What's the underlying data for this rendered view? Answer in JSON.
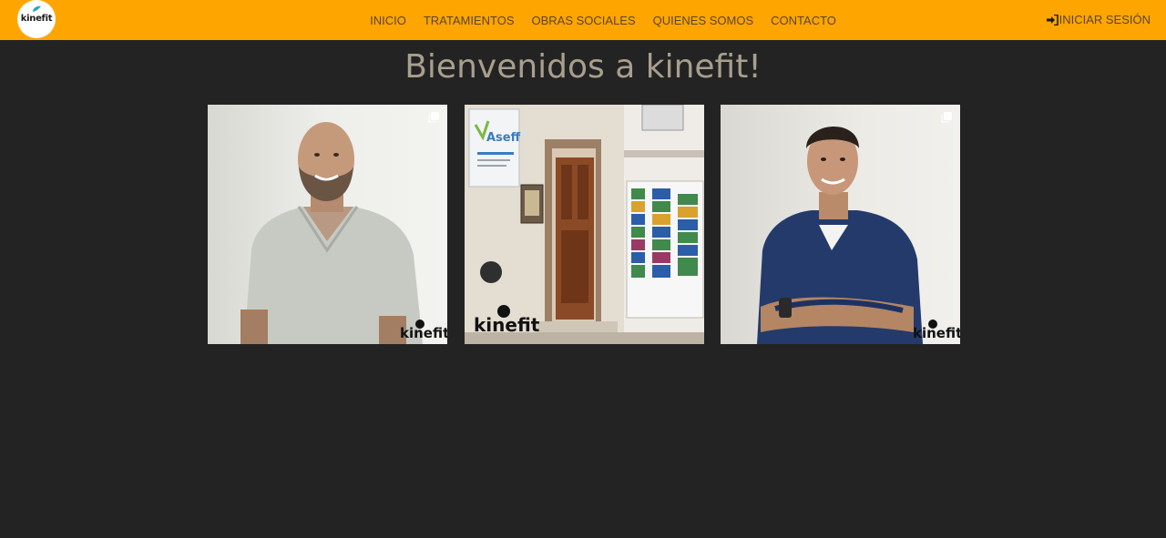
{
  "brand": {
    "logo_text": "kinefit",
    "accent": "#ffa500"
  },
  "nav": {
    "items": [
      {
        "label": "INICIO"
      },
      {
        "label": "TRATAMIENTOS"
      },
      {
        "label": "OBRAS SOCIALES"
      },
      {
        "label": "QUIENES SOMOS"
      },
      {
        "label": "CONTACTO"
      }
    ],
    "login_label": "INICIAR SESIÓN",
    "login_icon": "sign-in-icon"
  },
  "main": {
    "title": "Bienvenidos a kinefit!",
    "photos": [
      {
        "watermark": "kinefit"
      },
      {
        "watermark": "kinefit",
        "sign_text": "Aseff"
      },
      {
        "watermark": "kinefit"
      }
    ]
  },
  "colors": {
    "background": "#232323",
    "title": "#a89f8e",
    "nav_text": "#5a4630"
  }
}
